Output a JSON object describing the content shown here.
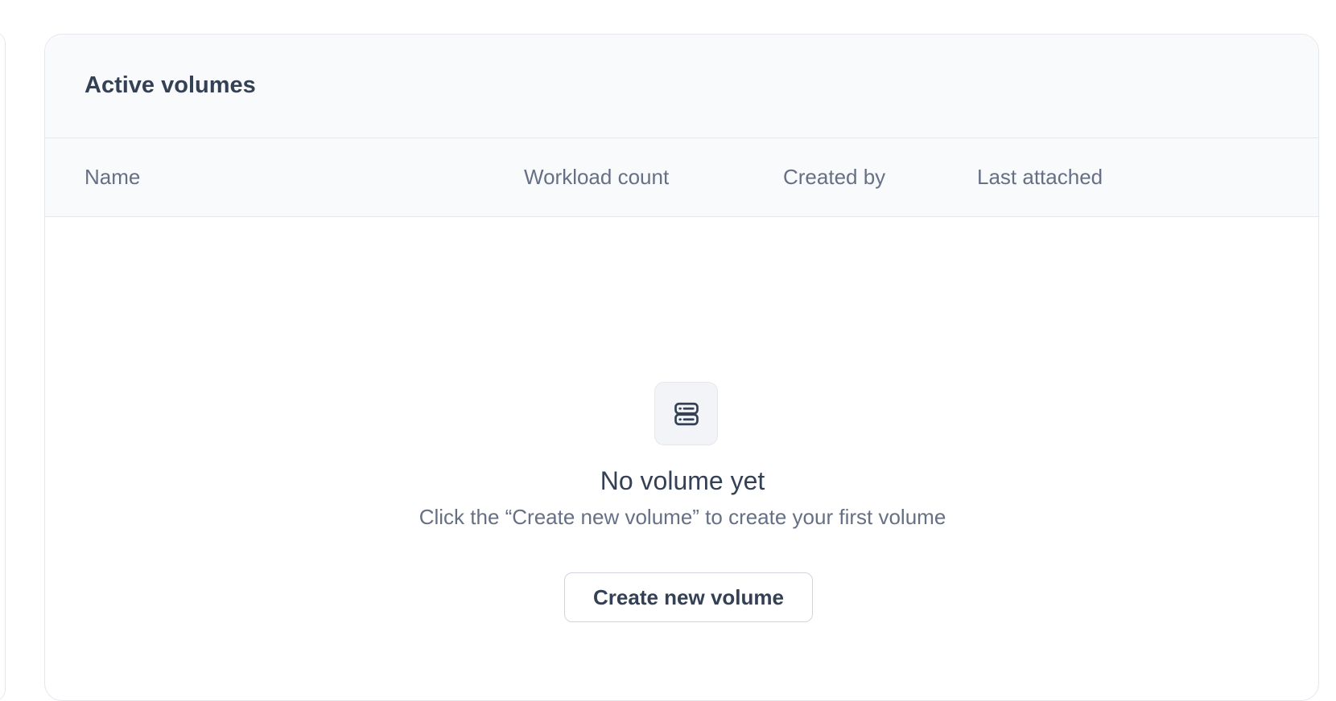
{
  "card": {
    "title": "Active volumes"
  },
  "table": {
    "columns": [
      "Name",
      "Workload count",
      "Created by",
      "Last attached"
    ],
    "rows": []
  },
  "empty_state": {
    "icon": "server-stack-icon",
    "title": "No volume yet",
    "subtitle": "Click the “Create new volume” to create your first volume",
    "button_label": "Create new volume"
  }
}
